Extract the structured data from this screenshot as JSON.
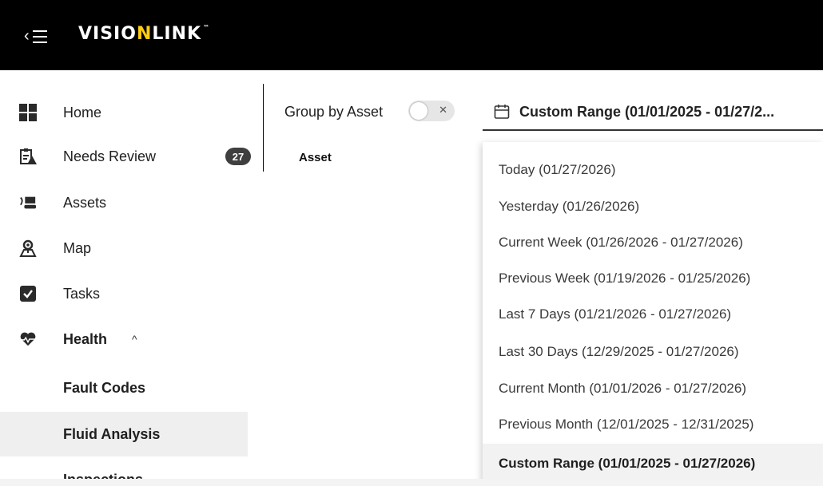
{
  "header": {
    "logo_prefix": "VISIO",
    "logo_accent": "N",
    "logo_suffix": "LINK",
    "logo_tm": "™",
    "menu_icon": "menu-collapse-icon"
  },
  "sidebar": {
    "items": [
      {
        "label": "Home",
        "icon": "home-grid-icon"
      },
      {
        "label": "Needs Review",
        "icon": "clipboard-alert-icon",
        "badge": "27"
      },
      {
        "label": "Assets",
        "icon": "machine-icon"
      },
      {
        "label": "Map",
        "icon": "map-pin-icon"
      },
      {
        "label": "Tasks",
        "icon": "task-check-icon"
      },
      {
        "label": "Health",
        "icon": "heart-pulse-icon"
      }
    ],
    "health_sub": [
      {
        "label": "Fault Codes"
      },
      {
        "label": "Fluid Analysis",
        "active": true
      },
      {
        "label": "Inspections"
      }
    ]
  },
  "toolbar": {
    "group_by_label": "Group by Asset",
    "group_by_on": false,
    "date_range_label": "Custom Range (01/01/2025 - 01/27/2..."
  },
  "table": {
    "columns": [
      "Asset"
    ]
  },
  "date_dropdown": {
    "options": [
      {
        "label": "Today (01/27/2026)"
      },
      {
        "label": "Yesterday (01/26/2026)"
      },
      {
        "label": "Current Week (01/26/2026 - 01/27/2026)"
      },
      {
        "label": "Previous Week (01/19/2026 - 01/25/2026)"
      },
      {
        "label": "Last 7 Days (01/21/2026 - 01/27/2026)"
      },
      {
        "label": "Last 30 Days (12/29/2025 - 01/27/2026)"
      },
      {
        "label": "Current Month (01/01/2026 - 01/27/2026)"
      },
      {
        "label": "Previous Month (12/01/2025 - 12/31/2025)"
      },
      {
        "label": "Custom Range (01/01/2025 - 01/27/2026)",
        "selected": true
      }
    ]
  },
  "colors": {
    "header_bg": "#000000",
    "logo_accent": "#ffcd11",
    "badge_bg": "#3f3f3f"
  }
}
